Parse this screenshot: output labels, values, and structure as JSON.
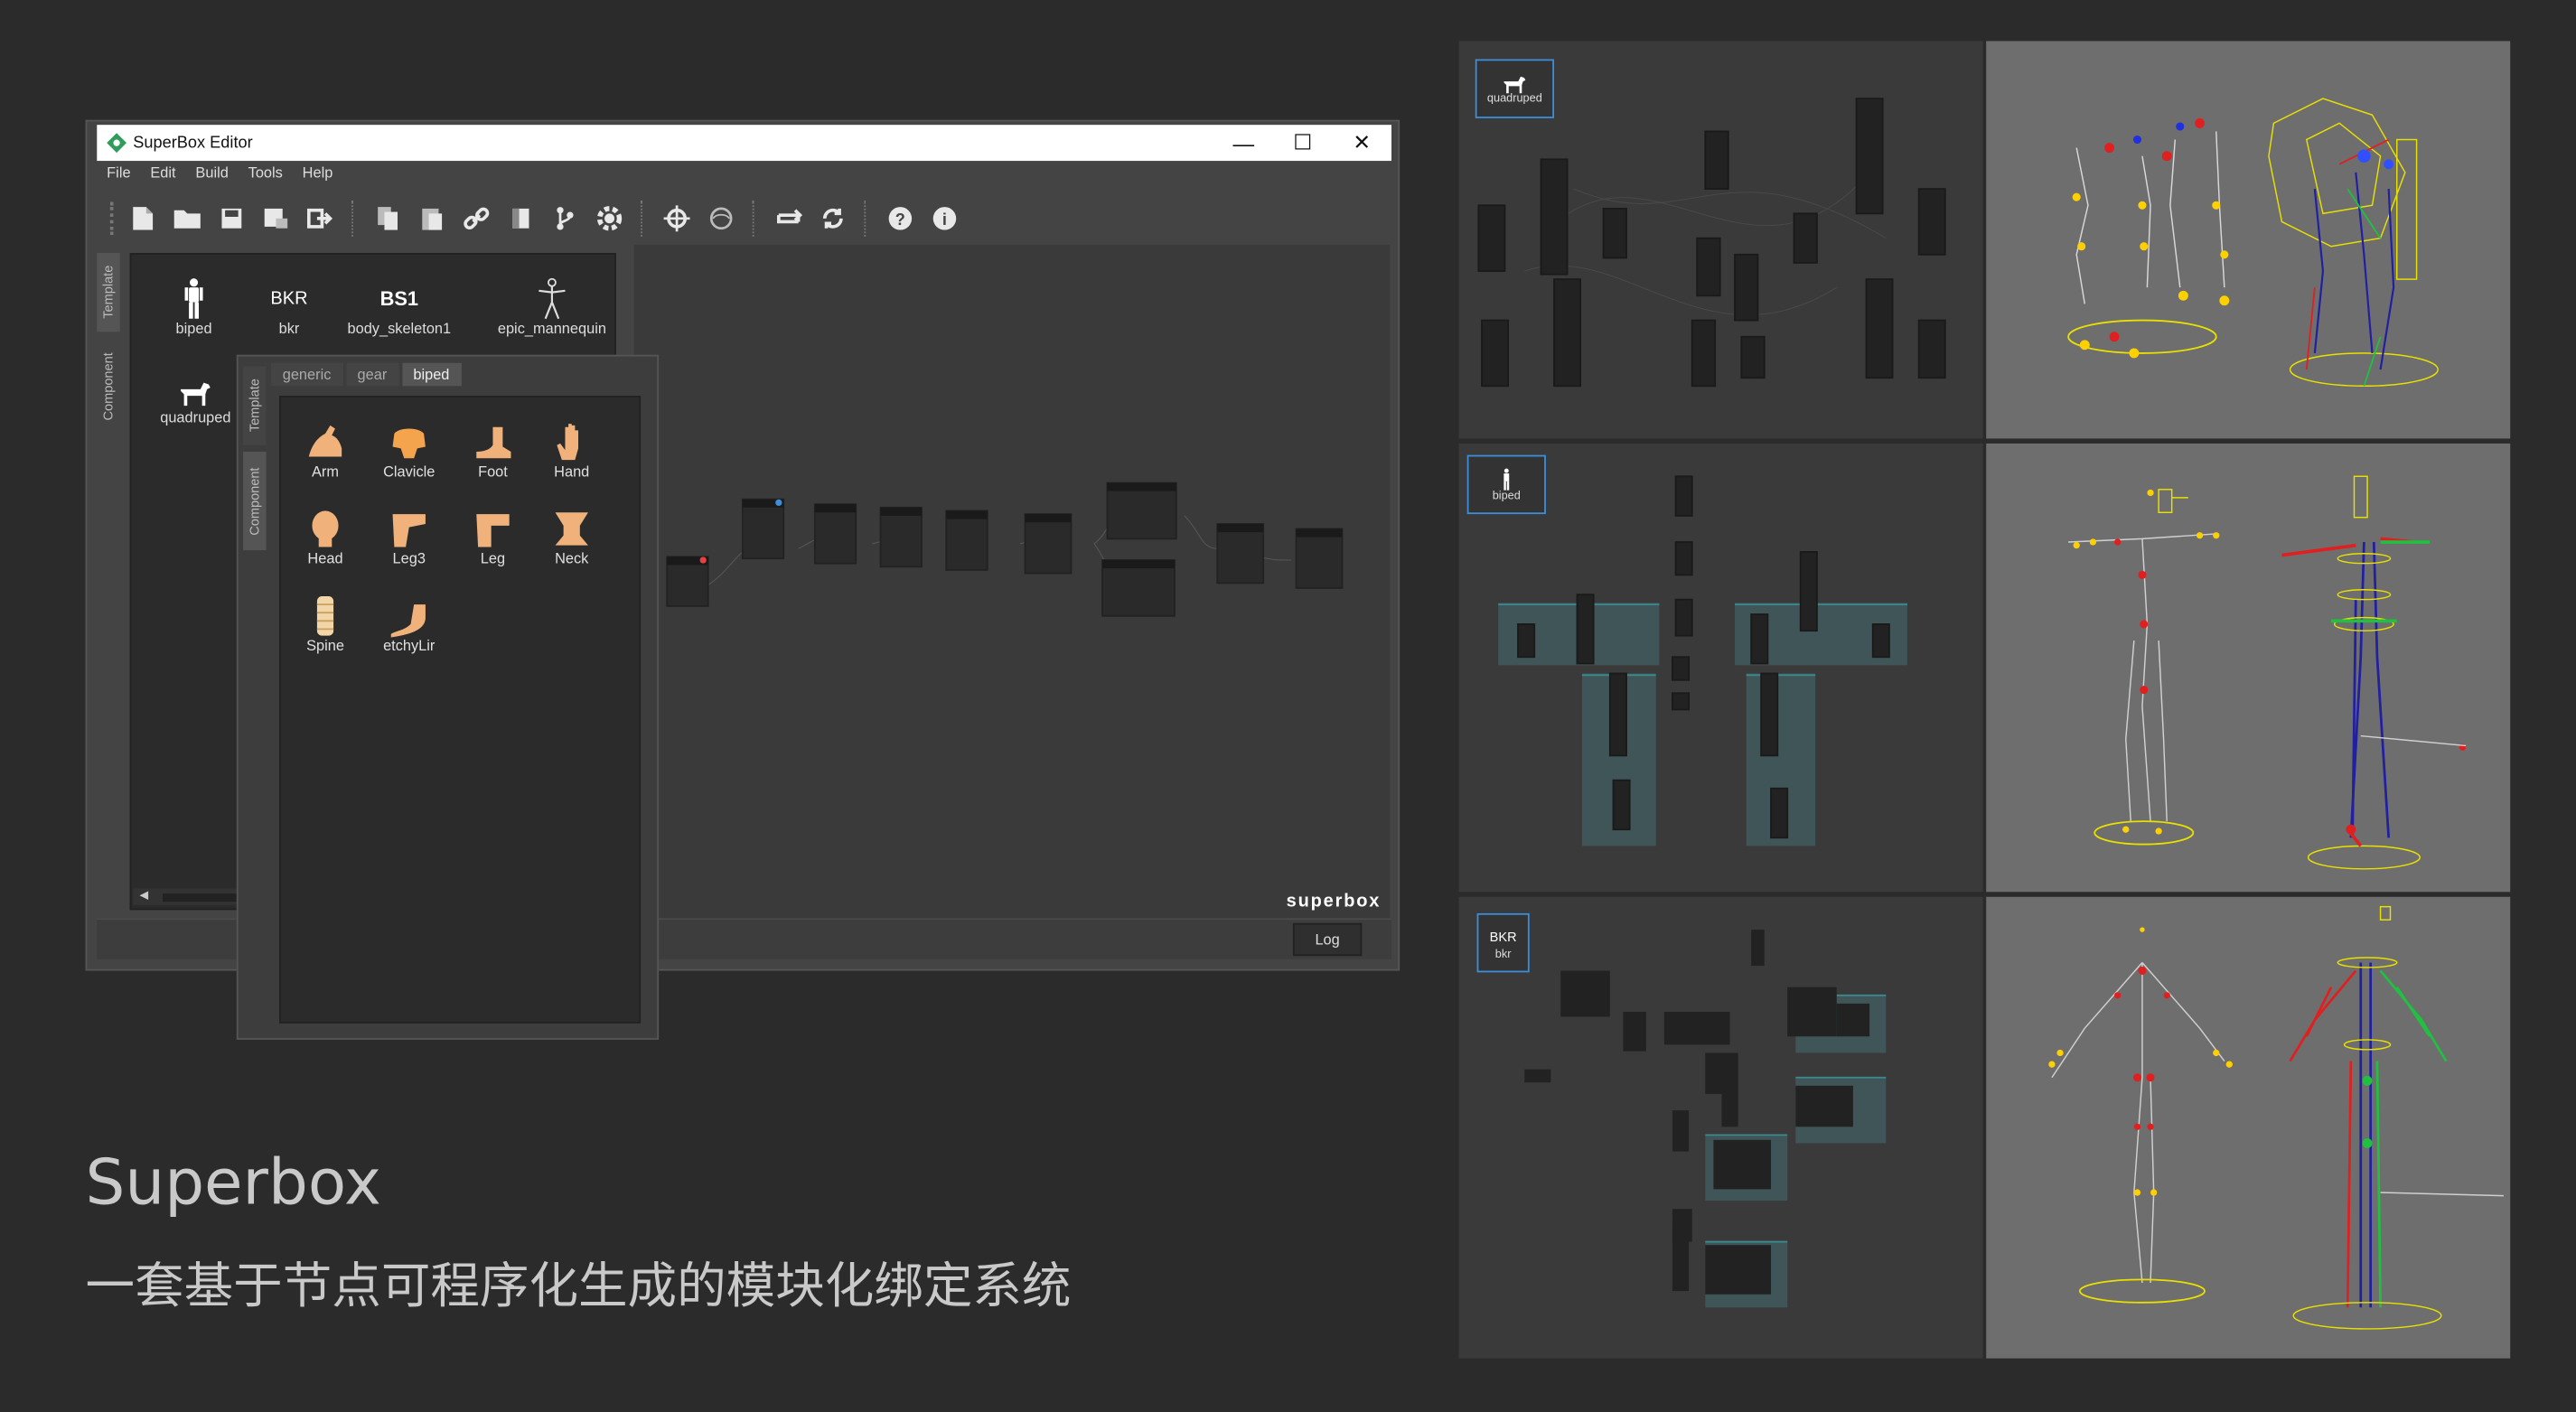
{
  "window": {
    "title": "SuperBox Editor",
    "controls": [
      "—",
      "☐",
      "✕"
    ],
    "menu": [
      "File",
      "Edit",
      "Build",
      "Tools",
      "Help"
    ],
    "watermark": "superbox",
    "log_button": "Log",
    "vertical_tabs": [
      "Template",
      "Component"
    ]
  },
  "templates": [
    {
      "icon": "",
      "label": "biped"
    },
    {
      "icon": "BKR",
      "label": "bkr"
    },
    {
      "icon": "BS1",
      "label": "body_skeleton1"
    },
    {
      "icon": "",
      "label": "epic_mannequin"
    },
    {
      "icon": "",
      "label": "quadruped"
    }
  ],
  "component_panel": {
    "vertical_tabs": [
      "Template",
      "Component"
    ],
    "tabs": [
      "generic",
      "gear",
      "biped"
    ],
    "active_tab": "biped",
    "items": [
      "Arm",
      "Clavicle",
      "Foot",
      "Hand",
      "Head",
      "Leg3",
      "Leg",
      "Neck",
      "Spine",
      "etchyLir"
    ]
  },
  "previews": [
    {
      "badge_icon": "",
      "badge_label": "quadruped"
    },
    {
      "badge_icon": "",
      "badge_label": "biped"
    },
    {
      "badge_icon": "BKR",
      "badge_label": "bkr"
    }
  ],
  "footer": {
    "title": "Superbox",
    "subtitle": "一套基于节点可程序化生成的模块化绑定系统"
  },
  "colors": {
    "background": "#2b2b2b",
    "accent": "#3c8ed8",
    "skin": "#f0b27a",
    "viewport": "#6e6e6e"
  }
}
